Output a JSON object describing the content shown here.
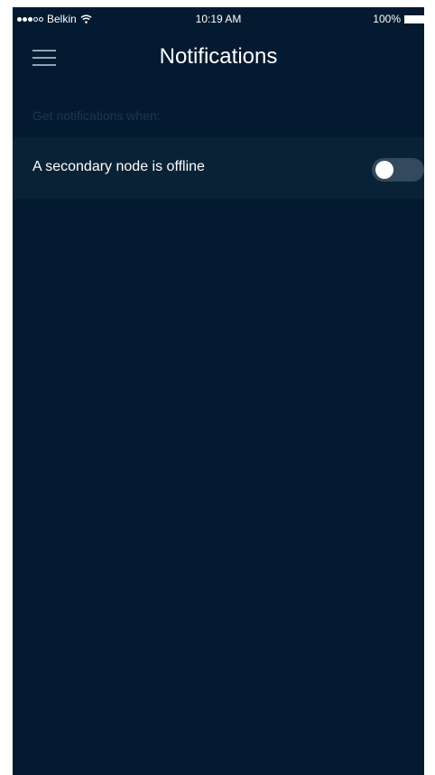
{
  "status_bar": {
    "carrier": "Belkin",
    "time": "10:19 AM",
    "battery": "100%",
    "signal_bars_filled": 3,
    "signal_bars_total": 5
  },
  "header": {
    "title": "Notifications",
    "menu_icon": "hamburger-menu-icon"
  },
  "section": {
    "label": "Get notifications when:"
  },
  "settings": [
    {
      "label": "A secondary node is offline",
      "enabled": false
    }
  ],
  "colors": {
    "background": "#031a30",
    "row_background": "#0a2236",
    "muted_text": "#1e3650",
    "toggle_off": "#33495e"
  }
}
